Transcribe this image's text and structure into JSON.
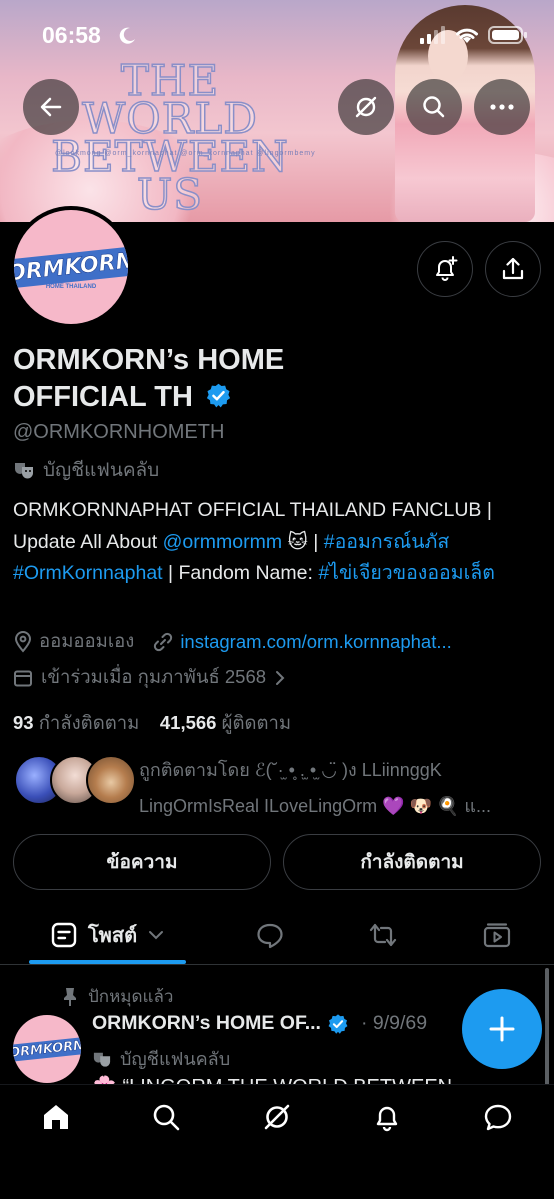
{
  "status_bar": {
    "time": "06:58"
  },
  "banner": {
    "title_line1": "THE WORLD",
    "title_line2": "BETWEEN US",
    "handles": "@lookmong   @orm_kornnaphat   @orm_kornnaphat   @lingormbemy"
  },
  "profile": {
    "name": "ORMKORN’s HOME OFFICIAL TH",
    "handle": "@ORMKORNHOMETH",
    "account_type": "บัญชีแฟนคลับ",
    "avatar_logo": "ORMKORN",
    "avatar_sub": "HOME THAILAND",
    "verified_color": "#1d9bf0"
  },
  "bio": {
    "part1": "ORMKORNNAPHAT OFFICIAL THAILAND FANCLUB | Update All About ",
    "mention": "@ormmormm",
    "part2": " 🐱 | ",
    "hashtag1": "#ออมกรณ์นภัส",
    "space": " ",
    "hashtag2": "#OrmKornnaphat",
    "part3": " | Fandom Name: ",
    "hashtag3": "#ไข่เจียวของออมเล็ต"
  },
  "meta": {
    "location": "ออมออมเอง",
    "website": "instagram.com/orm.kornnaphat...",
    "joined": "เข้าร่วมเมื่อ กุมภาพันธ์ 2568"
  },
  "counts": {
    "following_num": "93",
    "following_label": "กำลังติดตาม",
    "followers_num": "41,566",
    "followers_label": "ผู้ติดตาม"
  },
  "followed_by": {
    "line1": "ถูกติดตามโดย ℰ(˘·̫ •̥ .̫ •̫ ◡̈ )ง LLiinnggK",
    "line2": "LingOrmIsReal ILoveLingOrm 💜 🐶 🍳 แ..."
  },
  "buttons": {
    "message": "ข้อความ",
    "following": "กำลังติดตาม"
  },
  "tabs": {
    "posts": "โพสต์"
  },
  "post": {
    "pinned": "ปักหมุดแล้ว",
    "author": "ORMKORN’s HOME OF...",
    "date": "· 9/9/69",
    "account_type": "บัญชีแฟนคลับ",
    "text_preview": "🌸 “LINGORM THE WORLD BETWEEN"
  },
  "colors": {
    "accent": "#1d9bf0",
    "background": "#000000",
    "muted": "#71767b"
  }
}
